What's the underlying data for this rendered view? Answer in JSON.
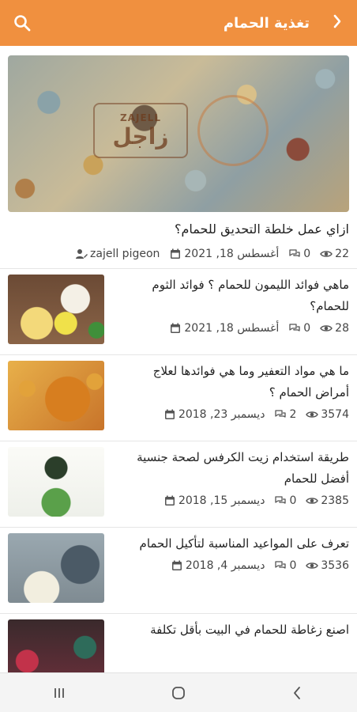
{
  "app_bar": {
    "title": "تغذية الحمام",
    "back_icon": "chevron-right-icon",
    "search_icon": "search-icon",
    "color": "#f0903f"
  },
  "featured": {
    "title": "ازاي عمل خلطة التحديق للحمام؟",
    "views": "22",
    "comments": "0",
    "date": "أغسطس 18, 2021",
    "author": "zajell pigeon",
    "image_logo_text": "زاجل",
    "image_logo_en": "ZAJELL"
  },
  "articles": [
    {
      "title": "ماهي فوائد الليمون للحمام ؟ فوائد الثوم للحمام؟",
      "views": "28",
      "comments": "0",
      "date": "أغسطس 18, 2021"
    },
    {
      "title": "ما هي مواد التعفير وما هي فوائدها لعلاج أمراض الحمام ؟",
      "views": "3574",
      "comments": "2",
      "date": "ديسمبر 23, 2018"
    },
    {
      "title": "طريقة استخدام زيت الكرفس لصحة جنسية أفضل للحمام",
      "views": "2385",
      "comments": "0",
      "date": "ديسمبر 15, 2018"
    },
    {
      "title": "تعرف على المواعيد المناسبة لتأكيل الحمام",
      "views": "3536",
      "comments": "0",
      "date": "ديسمبر 4, 2018"
    },
    {
      "title": "اصنع زغاطة للحمام في البيت بأقل تكلفة",
      "views": "",
      "comments": "",
      "date": ""
    }
  ],
  "icons": {
    "views": "eye-icon",
    "comments": "comments-icon",
    "date": "calendar-icon",
    "author": "user-edit-icon"
  },
  "nav": {
    "back": "nav-back-icon",
    "home": "nav-home-icon",
    "recents": "nav-recents-icon"
  }
}
